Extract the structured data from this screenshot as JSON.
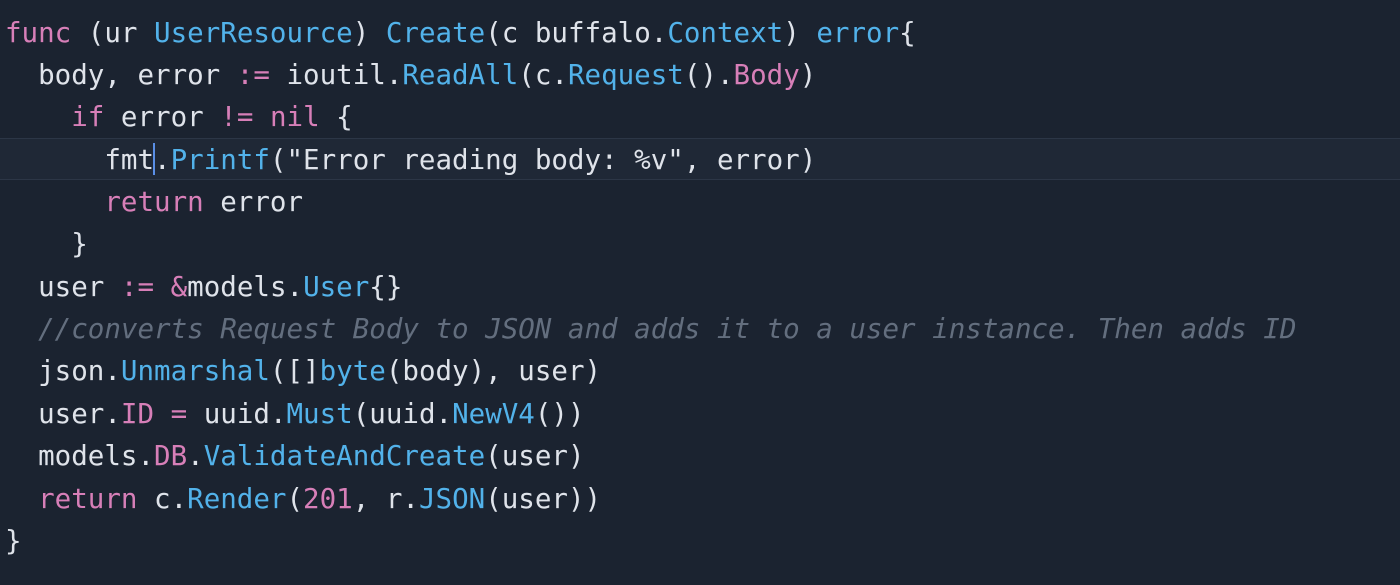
{
  "editor": {
    "colors": {
      "background": "#1b2330",
      "text": "#dfe3ea",
      "keyword": "#d77fb8",
      "function": "#52b2ea",
      "comment": "#636e7e",
      "caret": "#5a8fe6"
    },
    "lines": [
      {
        "tokens": [
          {
            "t": "func",
            "k": "keyword"
          },
          {
            "t": " (ur ",
            "k": "plain"
          },
          {
            "t": "UserResource",
            "k": "type"
          },
          {
            "t": ") ",
            "k": "plain"
          },
          {
            "t": "Create",
            "k": "function"
          },
          {
            "t": "(c buffalo.",
            "k": "plain"
          },
          {
            "t": "Context",
            "k": "type"
          },
          {
            "t": ") ",
            "k": "plain"
          },
          {
            "t": "error",
            "k": "type"
          },
          {
            "t": "{",
            "k": "plain"
          }
        ]
      },
      {
        "tokens": [
          {
            "t": "  body, error ",
            "k": "plain"
          },
          {
            "t": ":=",
            "k": "keyword"
          },
          {
            "t": " ioutil.",
            "k": "plain"
          },
          {
            "t": "ReadAll",
            "k": "function"
          },
          {
            "t": "(c.",
            "k": "plain"
          },
          {
            "t": "Request",
            "k": "function"
          },
          {
            "t": "().",
            "k": "plain"
          },
          {
            "t": "Body",
            "k": "field"
          },
          {
            "t": ")",
            "k": "plain"
          }
        ]
      },
      {
        "tokens": [
          {
            "t": "    ",
            "k": "plain"
          },
          {
            "t": "if",
            "k": "keyword"
          },
          {
            "t": " error ",
            "k": "plain"
          },
          {
            "t": "!=",
            "k": "keyword"
          },
          {
            "t": " ",
            "k": "plain"
          },
          {
            "t": "nil",
            "k": "keyword"
          },
          {
            "t": " {",
            "k": "plain"
          }
        ]
      },
      {
        "current": true,
        "tokens": [
          {
            "t": "      fmt",
            "k": "plain"
          },
          {
            "caret": true
          },
          {
            "t": ".",
            "k": "plain"
          },
          {
            "t": "Printf",
            "k": "function"
          },
          {
            "t": "(\"Error reading body: %v\", error)",
            "k": "plain"
          }
        ]
      },
      {
        "tokens": [
          {
            "t": "      ",
            "k": "plain"
          },
          {
            "t": "return",
            "k": "keyword"
          },
          {
            "t": " error",
            "k": "plain"
          }
        ]
      },
      {
        "tokens": [
          {
            "t": "    }",
            "k": "plain"
          }
        ]
      },
      {
        "tokens": [
          {
            "t": "  user ",
            "k": "plain"
          },
          {
            "t": ":=",
            "k": "keyword"
          },
          {
            "t": " ",
            "k": "plain"
          },
          {
            "t": "&",
            "k": "keyword"
          },
          {
            "t": "models.",
            "k": "plain"
          },
          {
            "t": "User",
            "k": "type"
          },
          {
            "t": "{}",
            "k": "plain"
          }
        ]
      },
      {
        "tokens": [
          {
            "t": "  //converts Request Body to JSON and adds it to a user instance. Then adds ID",
            "k": "comment"
          }
        ]
      },
      {
        "tokens": [
          {
            "t": "  json.",
            "k": "plain"
          },
          {
            "t": "Unmarshal",
            "k": "function"
          },
          {
            "t": "([]",
            "k": "plain"
          },
          {
            "t": "byte",
            "k": "type"
          },
          {
            "t": "(body), user)",
            "k": "plain"
          }
        ]
      },
      {
        "tokens": [
          {
            "t": "  user.",
            "k": "plain"
          },
          {
            "t": "ID",
            "k": "field"
          },
          {
            "t": " ",
            "k": "plain"
          },
          {
            "t": "=",
            "k": "keyword"
          },
          {
            "t": " uuid.",
            "k": "plain"
          },
          {
            "t": "Must",
            "k": "function"
          },
          {
            "t": "(uuid.",
            "k": "plain"
          },
          {
            "t": "NewV4",
            "k": "function"
          },
          {
            "t": "())",
            "k": "plain"
          }
        ]
      },
      {
        "tokens": [
          {
            "t": "  models.",
            "k": "plain"
          },
          {
            "t": "DB",
            "k": "field"
          },
          {
            "t": ".",
            "k": "plain"
          },
          {
            "t": "ValidateAndCreate",
            "k": "function"
          },
          {
            "t": "(user)",
            "k": "plain"
          }
        ]
      },
      {
        "tokens": [
          {
            "t": "  ",
            "k": "plain"
          },
          {
            "t": "return",
            "k": "keyword"
          },
          {
            "t": " c.",
            "k": "plain"
          },
          {
            "t": "Render",
            "k": "function"
          },
          {
            "t": "(",
            "k": "plain"
          },
          {
            "t": "201",
            "k": "number"
          },
          {
            "t": ", r.",
            "k": "plain"
          },
          {
            "t": "JSON",
            "k": "function"
          },
          {
            "t": "(user))",
            "k": "plain"
          }
        ]
      },
      {
        "tokens": [
          {
            "t": "}",
            "k": "plain"
          }
        ]
      }
    ]
  }
}
